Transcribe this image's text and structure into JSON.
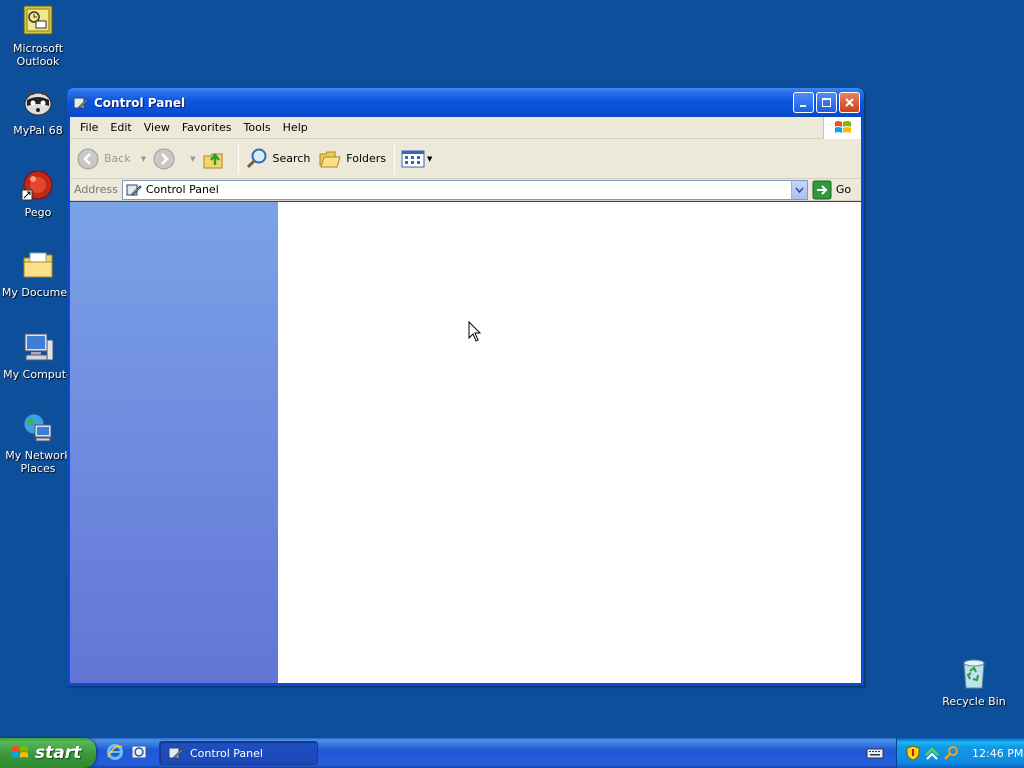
{
  "desktop": {
    "icons": [
      {
        "label": "Microsoft Outlook",
        "icon": "outlook-icon"
      },
      {
        "label": "MyPal 68",
        "icon": "mypal-raccoon-icon"
      },
      {
        "label": "Pego",
        "icon": "pego-red-ball-icon"
      },
      {
        "label": "My Documents",
        "icon": "my-documents-folder-icon"
      },
      {
        "label": "My Computer",
        "icon": "my-computer-icon"
      },
      {
        "label": "My Network Places",
        "icon": "my-network-places-icon"
      },
      {
        "label": "Recycle Bin",
        "icon": "recycle-bin-icon"
      }
    ],
    "icon_labels": {
      "outlook_line1": "Microsoft",
      "outlook_line2": "Outlook",
      "mypal": "MyPal 68",
      "pego": "Pego",
      "documents": "My Documen",
      "computer": "My Compute",
      "network_line1": "My Network",
      "network_line2": "Places",
      "recycle": "Recycle Bin"
    }
  },
  "window": {
    "title": "Control Panel",
    "menu": [
      "File",
      "Edit",
      "View",
      "Favorites",
      "Tools",
      "Help"
    ],
    "toolbar": {
      "back": "Back",
      "search": "Search",
      "folders": "Folders"
    },
    "address": {
      "label": "Address",
      "value": "Control Panel",
      "go": "Go"
    }
  },
  "taskbar": {
    "start": "start",
    "task_button": "Control Panel",
    "clock": "12:46 PM"
  },
  "colors": {
    "desktop": "#0d4f9a",
    "titlebar": "#0a4fd6",
    "taskpane_top": "#7ba2e7",
    "taskpane_bottom": "#6375d6",
    "start_green": "#3c963c"
  }
}
